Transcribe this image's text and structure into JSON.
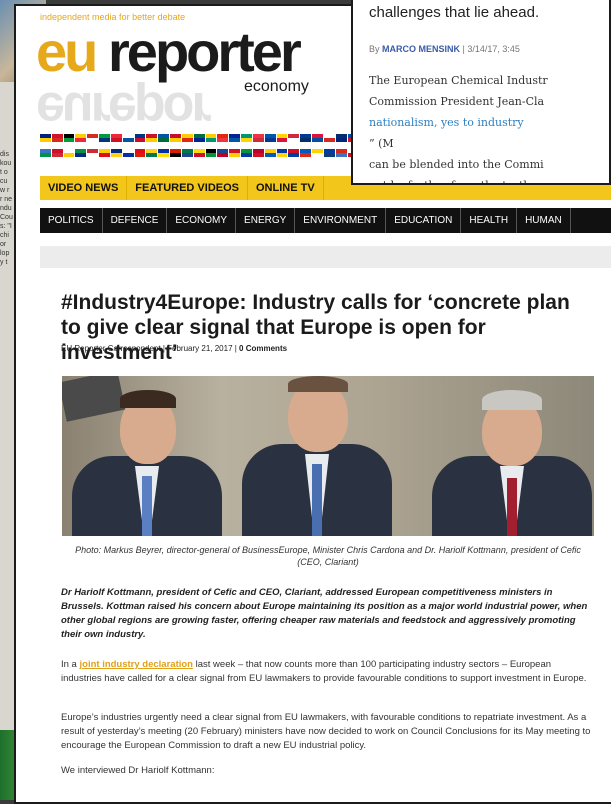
{
  "left_clipping": {
    "snippets": [
      "dis",
      "kou",
      "t o",
      "cu",
      "w r",
      "r ne",
      "ndu",
      "Cou",
      "s: \"I",
      "chi",
      "or",
      "lop",
      "y t"
    ]
  },
  "main_clipping": {
    "tagline": "independent media for better debate",
    "logo": {
      "eu": "eu",
      "reporter": "reporter",
      "section": "economy",
      "reflection": "eurepor"
    },
    "flag_rows": [
      [
        "#00247d",
        "#cf142b",
        "#000000",
        "#ffcd00",
        "#d52b1e",
        "#009b3a",
        "#ed2939",
        "#ffffff",
        "#003580",
        "#ce1126",
        "#0055a4",
        "#c60c30",
        "#ffcc00",
        "#006b3f",
        "#fecb00",
        "#de2910",
        "#002395",
        "#00966e",
        "#ef3340",
        "#0055a4",
        "#ffd700",
        "#cd2a3e",
        "#003893",
        "#dc143c",
        "#ffffff",
        "#002f6c",
        "#0050a0",
        "#d52b1e"
      ],
      [
        "#3a75c4",
        "#ce1126",
        "#ffffff",
        "#009246",
        "#ce2b37",
        "#ffce00",
        "#002b7f",
        "#ffffff",
        "#e30a17",
        "#fcd116",
        "#0032a0",
        "#d81e05",
        "#007a4d",
        "#fcdd09",
        "#000000",
        "#21468b",
        "#ce1126",
        "#009639",
        "#bc002d",
        "#ffcc00",
        "#0038a8",
        "#ce1126",
        "#005bbb",
        "#ffd500",
        "#003da5",
        "#da291c",
        "#ffffff",
        "#0c4076"
      ]
    ],
    "nav_primary": [
      "VIDEO NEWS",
      "FEATURED VIDEOS",
      "ONLINE TV"
    ],
    "nav_secondary": [
      "POLITICS",
      "DEFENCE",
      "ECONOMY",
      "ENERGY",
      "ENVIRONMENT",
      "EDUCATION",
      "HEALTH",
      "HUMAN"
    ],
    "article": {
      "title": "#Industry4Europe: Industry calls for ‘concrete plan to give clear signal that Europe is open for investment’",
      "byline_author": "EU Reporter Correspondent",
      "byline_date": "February 21, 2017",
      "byline_comments": "0 Comments",
      "caption": "Photo: Markus Beyrer, director-general of BusinessEurope, Minister Chris Cardona and Dr. Hariolf Kottmann, president of Cefic (CEO, Clariant)",
      "lead": "Dr Hariolf Kottmann, president of Cefic and CEO, Clariant, addressed European competitiveness ministers in Brussels. Kottman raised his concern about Europe maintaining its position as a major world industrial power, when other global regions are growing faster, offering cheaper raw materials and feedstock and aggressively promoting their own industry.",
      "p1_pre": "In a ",
      "p1_link": "joint industry declaration",
      "p1_post": " last week – that now counts more than 100 participating industry sectors – European industries have called for a clear signal from EU lawmakers to provide favourable conditions to support investment in Europe.",
      "p2": "Europe’s industries urgently need a clear signal from EU lawmakers, with favourable conditions to repatriate investment. As a result of yesterday’s meeting (20 February) ministers have now decided to work on Council Conclusions for its May meeting to encourage the European Commission to draft a new EU industrial policy.",
      "p3": "We interviewed Dr Hariolf Kottmann:"
    }
  },
  "top_right_clipping": {
    "heading": "challenges that lie ahead.",
    "by_prefix": "By ",
    "author": "MARCO MENSINK",
    "date": " | 3/14/17, 3:45",
    "line1": "The European Chemical Industr",
    "line2": "Commission President Jean-Cla",
    "line3_link": "nationalism, yes to industry",
    "line3_rest": "” (M",
    "line4": "can be blended into the Commi",
    "line5": "not be further from the truth."
  }
}
